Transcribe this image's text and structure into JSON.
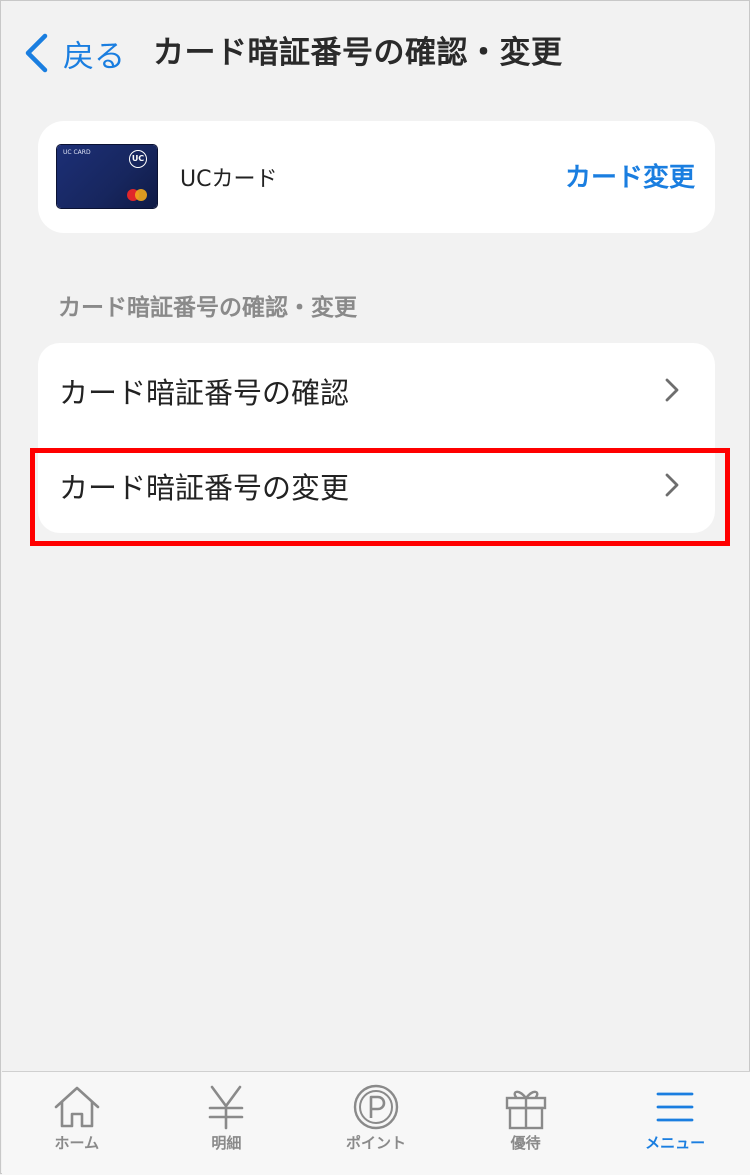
{
  "header": {
    "back_label": "戻る",
    "title": "カード暗証番号の確認・変更"
  },
  "card": {
    "name": "UCカード",
    "change_label": "カード変更",
    "image": {
      "brand_text": "UC CARD",
      "logo_text": "UC",
      "network": "MasterCard"
    }
  },
  "section": {
    "header": "カード暗証番号の確認・変更",
    "items": [
      {
        "label": "カード暗証番号の確認",
        "icon": "chevron-right-icon"
      },
      {
        "label": "カード暗証番号の変更",
        "icon": "chevron-right-icon",
        "highlighted": true
      }
    ]
  },
  "tabbar": {
    "tabs": [
      {
        "label": "ホーム",
        "icon": "home-icon",
        "active": false
      },
      {
        "label": "明細",
        "icon": "yen-icon",
        "active": false
      },
      {
        "label": "ポイント",
        "icon": "points-icon",
        "active": false
      },
      {
        "label": "優待",
        "icon": "gift-icon",
        "active": false
      },
      {
        "label": "メニュー",
        "icon": "menu-icon",
        "active": true
      }
    ]
  },
  "colors": {
    "accent": "#1a7ee0",
    "highlight": "#ff0000",
    "background": "#f2f2f2",
    "inactive_tab": "#8a8a8a"
  }
}
